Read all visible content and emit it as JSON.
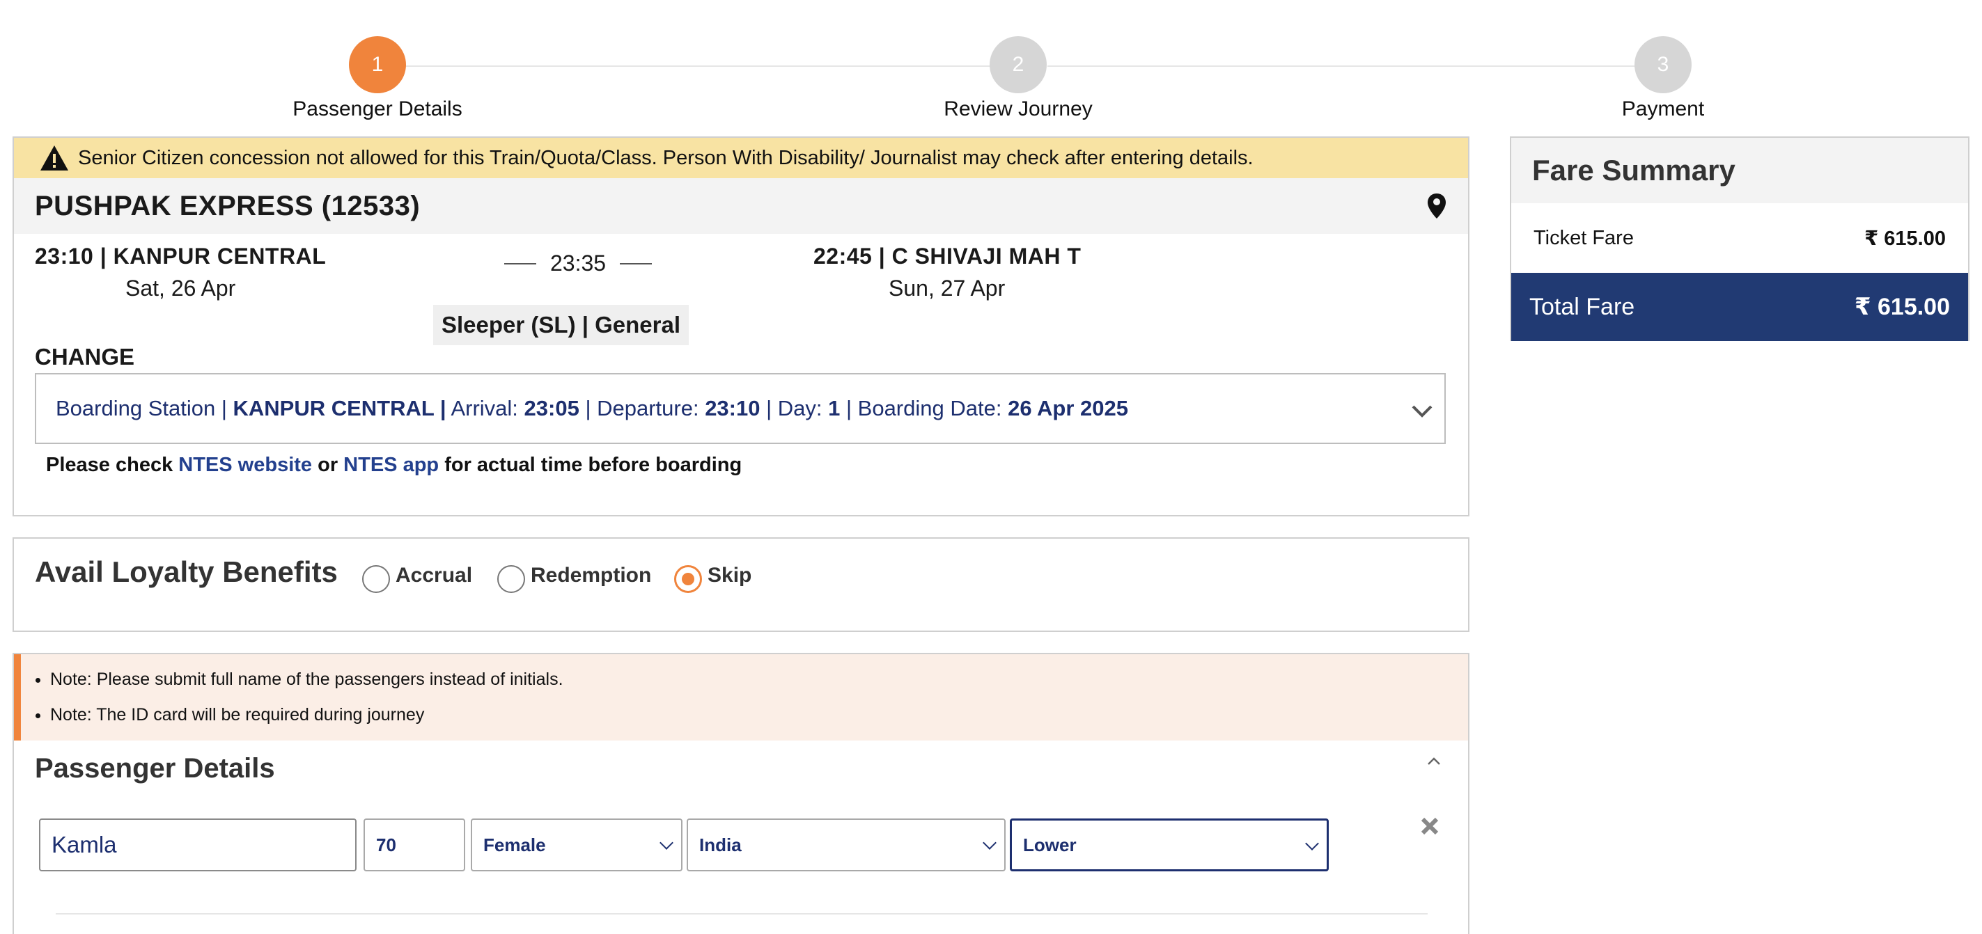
{
  "stepper": {
    "steps": [
      {
        "number": "1",
        "label": "Passenger Details"
      },
      {
        "number": "2",
        "label": "Review Journey"
      },
      {
        "number": "3",
        "label": "Payment"
      }
    ]
  },
  "warning": {
    "text": "Senior Citizen concession not allowed for this Train/Quota/Class. Person With Disability/ Journalist may check after entering details."
  },
  "train": {
    "name": "PUSHPAK EXPRESS (12533)",
    "from": {
      "time_station": "23:10 | KANPUR CENTRAL",
      "date": "Sat, 26 Apr"
    },
    "duration": "23:35",
    "to": {
      "time_station": "22:45 | C SHIVAJI MAH T",
      "date": "Sun, 27 Apr"
    },
    "class_quota": "Sleeper (SL) | General",
    "change_label": "CHANGE",
    "boarding": {
      "label_station": "Boarding Station | ",
      "station": "KANPUR CENTRAL |",
      "label_arrival": " Arrival: ",
      "arrival": "23:05",
      "label_departure": " | Departure: ",
      "departure": "23:10",
      "label_day": " | Day: ",
      "day": "1",
      "label_date": " | Boarding Date: ",
      "date": "26 Apr 2025"
    },
    "check_note": {
      "prefix": "Please check ",
      "link1": "NTES website",
      "middle": " or ",
      "link2": "NTES app",
      "suffix": " for actual time before boarding"
    }
  },
  "loyalty": {
    "title": "Avail Loyalty Benefits",
    "options": [
      "Accrual",
      "Redemption",
      "Skip"
    ],
    "selected": "Skip"
  },
  "passenger": {
    "notes": [
      "Note: Please submit full name of the passengers instead of initials.",
      "Note: The ID card will be required during journey"
    ],
    "title": "Passenger Details",
    "name": "Kamla",
    "age": "70",
    "gender": "Female",
    "nationality": "India",
    "berth": "Lower"
  },
  "fare": {
    "title": "Fare Summary",
    "ticket_label": "Ticket Fare",
    "ticket_value": "₹ 615.00",
    "total_label": "Total Fare",
    "total_value": "₹ 615.00"
  },
  "colors": {
    "accent": "#f0843c",
    "navy": "#213a73",
    "warning_bg": "#f8e3a3",
    "note_bg": "#fbeee6"
  }
}
